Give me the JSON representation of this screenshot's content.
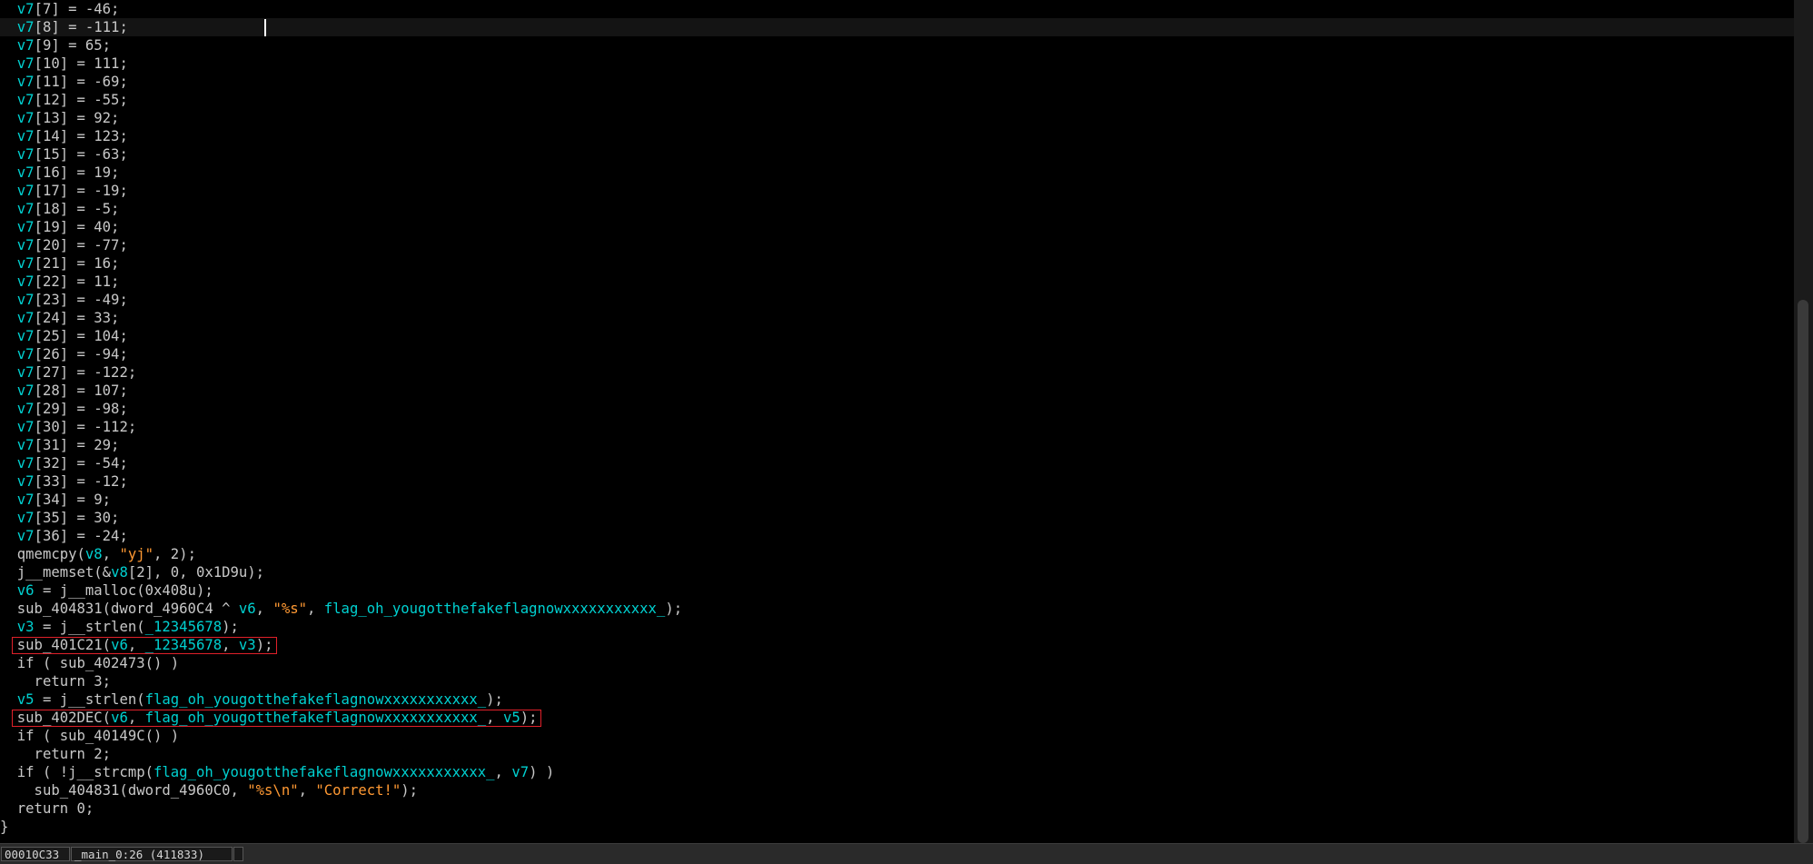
{
  "colors": {
    "background": "#000000",
    "var": "#00d0d0",
    "text": "#c8c8c8",
    "string": "#ff9933",
    "highlight_box": "#e0202a"
  },
  "code_lines": [
    [
      {
        "t": "  "
      },
      {
        "t": "v7",
        "c": "var"
      },
      {
        "t": "[7] = -46;"
      }
    ],
    [
      {
        "t": "  "
      },
      {
        "t": "v7",
        "c": "var"
      },
      {
        "t": "[8] = -111;"
      }
    ],
    [
      {
        "t": "  "
      },
      {
        "t": "v7",
        "c": "var"
      },
      {
        "t": "[9] = 65;"
      }
    ],
    [
      {
        "t": "  "
      },
      {
        "t": "v7",
        "c": "var"
      },
      {
        "t": "[10] = 111;"
      }
    ],
    [
      {
        "t": "  "
      },
      {
        "t": "v7",
        "c": "var"
      },
      {
        "t": "[11] = -69;"
      }
    ],
    [
      {
        "t": "  "
      },
      {
        "t": "v7",
        "c": "var"
      },
      {
        "t": "[12] = -55;"
      }
    ],
    [
      {
        "t": "  "
      },
      {
        "t": "v7",
        "c": "var"
      },
      {
        "t": "[13] = 92;"
      }
    ],
    [
      {
        "t": "  "
      },
      {
        "t": "v7",
        "c": "var"
      },
      {
        "t": "[14] = 123;"
      }
    ],
    [
      {
        "t": "  "
      },
      {
        "t": "v7",
        "c": "var"
      },
      {
        "t": "[15] = -63;"
      }
    ],
    [
      {
        "t": "  "
      },
      {
        "t": "v7",
        "c": "var"
      },
      {
        "t": "[16] = 19;"
      }
    ],
    [
      {
        "t": "  "
      },
      {
        "t": "v7",
        "c": "var"
      },
      {
        "t": "[17] = -19;"
      }
    ],
    [
      {
        "t": "  "
      },
      {
        "t": "v7",
        "c": "var"
      },
      {
        "t": "[18] = -5;"
      }
    ],
    [
      {
        "t": "  "
      },
      {
        "t": "v7",
        "c": "var"
      },
      {
        "t": "[19] = 40;"
      }
    ],
    [
      {
        "t": "  "
      },
      {
        "t": "v7",
        "c": "var"
      },
      {
        "t": "[20] = -77;"
      }
    ],
    [
      {
        "t": "  "
      },
      {
        "t": "v7",
        "c": "var"
      },
      {
        "t": "[21] = 16;"
      }
    ],
    [
      {
        "t": "  "
      },
      {
        "t": "v7",
        "c": "var"
      },
      {
        "t": "[22] = 11;"
      }
    ],
    [
      {
        "t": "  "
      },
      {
        "t": "v7",
        "c": "var"
      },
      {
        "t": "[23] = -49;"
      }
    ],
    [
      {
        "t": "  "
      },
      {
        "t": "v7",
        "c": "var"
      },
      {
        "t": "[24] = 33;"
      }
    ],
    [
      {
        "t": "  "
      },
      {
        "t": "v7",
        "c": "var"
      },
      {
        "t": "[25] = 104;"
      }
    ],
    [
      {
        "t": "  "
      },
      {
        "t": "v7",
        "c": "var"
      },
      {
        "t": "[26] = -94;"
      }
    ],
    [
      {
        "t": "  "
      },
      {
        "t": "v7",
        "c": "var"
      },
      {
        "t": "[27] = -122;"
      }
    ],
    [
      {
        "t": "  "
      },
      {
        "t": "v7",
        "c": "var"
      },
      {
        "t": "[28] = 107;"
      }
    ],
    [
      {
        "t": "  "
      },
      {
        "t": "v7",
        "c": "var"
      },
      {
        "t": "[29] = -98;"
      }
    ],
    [
      {
        "t": "  "
      },
      {
        "t": "v7",
        "c": "var"
      },
      {
        "t": "[30] = -112;"
      }
    ],
    [
      {
        "t": "  "
      },
      {
        "t": "v7",
        "c": "var"
      },
      {
        "t": "[31] = 29;"
      }
    ],
    [
      {
        "t": "  "
      },
      {
        "t": "v7",
        "c": "var"
      },
      {
        "t": "[32] = -54;"
      }
    ],
    [
      {
        "t": "  "
      },
      {
        "t": "v7",
        "c": "var"
      },
      {
        "t": "[33] = -12;"
      }
    ],
    [
      {
        "t": "  "
      },
      {
        "t": "v7",
        "c": "var"
      },
      {
        "t": "[34] = 9;"
      }
    ],
    [
      {
        "t": "  "
      },
      {
        "t": "v7",
        "c": "var"
      },
      {
        "t": "[35] = 30;"
      }
    ],
    [
      {
        "t": "  "
      },
      {
        "t": "v7",
        "c": "var"
      },
      {
        "t": "[36] = -24;"
      }
    ],
    [
      {
        "t": "  qmemcpy("
      },
      {
        "t": "v8",
        "c": "var"
      },
      {
        "t": ", "
      },
      {
        "t": "\"yj\"",
        "c": "string"
      },
      {
        "t": ", 2);"
      }
    ],
    [
      {
        "t": "  j__memset(&"
      },
      {
        "t": "v8",
        "c": "var"
      },
      {
        "t": "[2], 0, 0x1D9u);"
      }
    ],
    [
      {
        "t": "  "
      },
      {
        "t": "v6",
        "c": "var"
      },
      {
        "t": " = j__malloc(0x408u);"
      }
    ],
    [
      {
        "t": "  sub_404831(dword_4960C4 ^ "
      },
      {
        "t": "v6",
        "c": "var"
      },
      {
        "t": ", "
      },
      {
        "t": "\"%s\"",
        "c": "string"
      },
      {
        "t": ", "
      },
      {
        "t": "flag_oh_yougotthefakeflagnowxxxxxxxxxxx_",
        "c": "var"
      },
      {
        "t": ");"
      }
    ],
    [
      {
        "t": "  "
      },
      {
        "t": "v3",
        "c": "var"
      },
      {
        "t": " = j__strlen("
      },
      {
        "t": "_12345678",
        "c": "var"
      },
      {
        "t": ");"
      }
    ],
    [
      {
        "t": "  sub_401C21("
      },
      {
        "t": "v6",
        "c": "var"
      },
      {
        "t": ", "
      },
      {
        "t": "_12345678",
        "c": "var"
      },
      {
        "t": ", "
      },
      {
        "t": "v3",
        "c": "var"
      },
      {
        "t": ");"
      }
    ],
    [
      {
        "t": "  if ( sub_402473() )"
      }
    ],
    [
      {
        "t": "    return 3;"
      }
    ],
    [
      {
        "t": "  "
      },
      {
        "t": "v5",
        "c": "var"
      },
      {
        "t": " = j__strlen("
      },
      {
        "t": "flag_oh_yougotthefakeflagnowxxxxxxxxxxx_",
        "c": "var"
      },
      {
        "t": ");"
      }
    ],
    [
      {
        "t": "  sub_402DEC("
      },
      {
        "t": "v6",
        "c": "var"
      },
      {
        "t": ", "
      },
      {
        "t": "flag_oh_yougotthefakeflagnowxxxxxxxxxxx_",
        "c": "var"
      },
      {
        "t": ", "
      },
      {
        "t": "v5",
        "c": "var"
      },
      {
        "t": ");"
      }
    ],
    [
      {
        "t": "  if ( sub_40149C() )"
      }
    ],
    [
      {
        "t": "    return 2;"
      }
    ],
    [
      {
        "t": "  if ( !j__strcmp("
      },
      {
        "t": "flag_oh_yougotthefakeflagnowxxxxxxxxxxx_",
        "c": "var"
      },
      {
        "t": ", "
      },
      {
        "t": "v7",
        "c": "var"
      },
      {
        "t": ") )"
      }
    ],
    [
      {
        "t": "    sub_404831(dword_4960C0, "
      },
      {
        "t": "\"%s\\n\"",
        "c": "string"
      },
      {
        "t": ", "
      },
      {
        "t": "\"Correct!\"",
        "c": "string"
      },
      {
        "t": ");"
      }
    ],
    [
      {
        "t": "  return 0;"
      }
    ],
    [
      {
        "t": "}"
      }
    ]
  ],
  "current_line_index": 1,
  "highlighted_line_indices": [
    35,
    39
  ],
  "status": {
    "address": "00010C33",
    "location": "_main_0:26 (411833)"
  }
}
